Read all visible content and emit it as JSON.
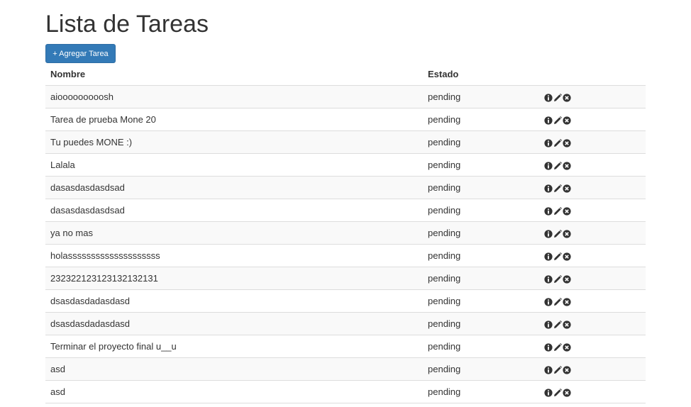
{
  "page": {
    "title": "Lista de Tareas",
    "add_button_label": "+ Agregar Tarea"
  },
  "table": {
    "headers": [
      "Nombre",
      "Estado",
      ""
    ],
    "rows": [
      {
        "name": "aiooooooooosh",
        "status": "pending"
      },
      {
        "name": "Tarea de prueba Mone 20",
        "status": "pending"
      },
      {
        "name": "Tu puedes MONE :)",
        "status": "pending"
      },
      {
        "name": "Lalala",
        "status": "pending"
      },
      {
        "name": "dasasdasdasdsad",
        "status": "pending"
      },
      {
        "name": "dasasdasdasdsad",
        "status": "pending"
      },
      {
        "name": "ya no mas",
        "status": "pending"
      },
      {
        "name": "holassssssssssssssssssss",
        "status": "pending"
      },
      {
        "name": "232322123123132132131",
        "status": "pending"
      },
      {
        "name": "dsasdasdadasdasd",
        "status": "pending"
      },
      {
        "name": "dsasdasdadasdasd",
        "status": "pending"
      },
      {
        "name": "Terminar el proyecto final u__u",
        "status": "pending"
      },
      {
        "name": "asd",
        "status": "pending"
      },
      {
        "name": "asd",
        "status": "pending"
      }
    ],
    "row_actions": [
      "info-icon",
      "pencil-icon",
      "remove-icon"
    ]
  },
  "colors": {
    "primary": "#337ab7",
    "row_stripe": "#f9f9f9",
    "border": "#dddddd",
    "text": "#333333"
  }
}
